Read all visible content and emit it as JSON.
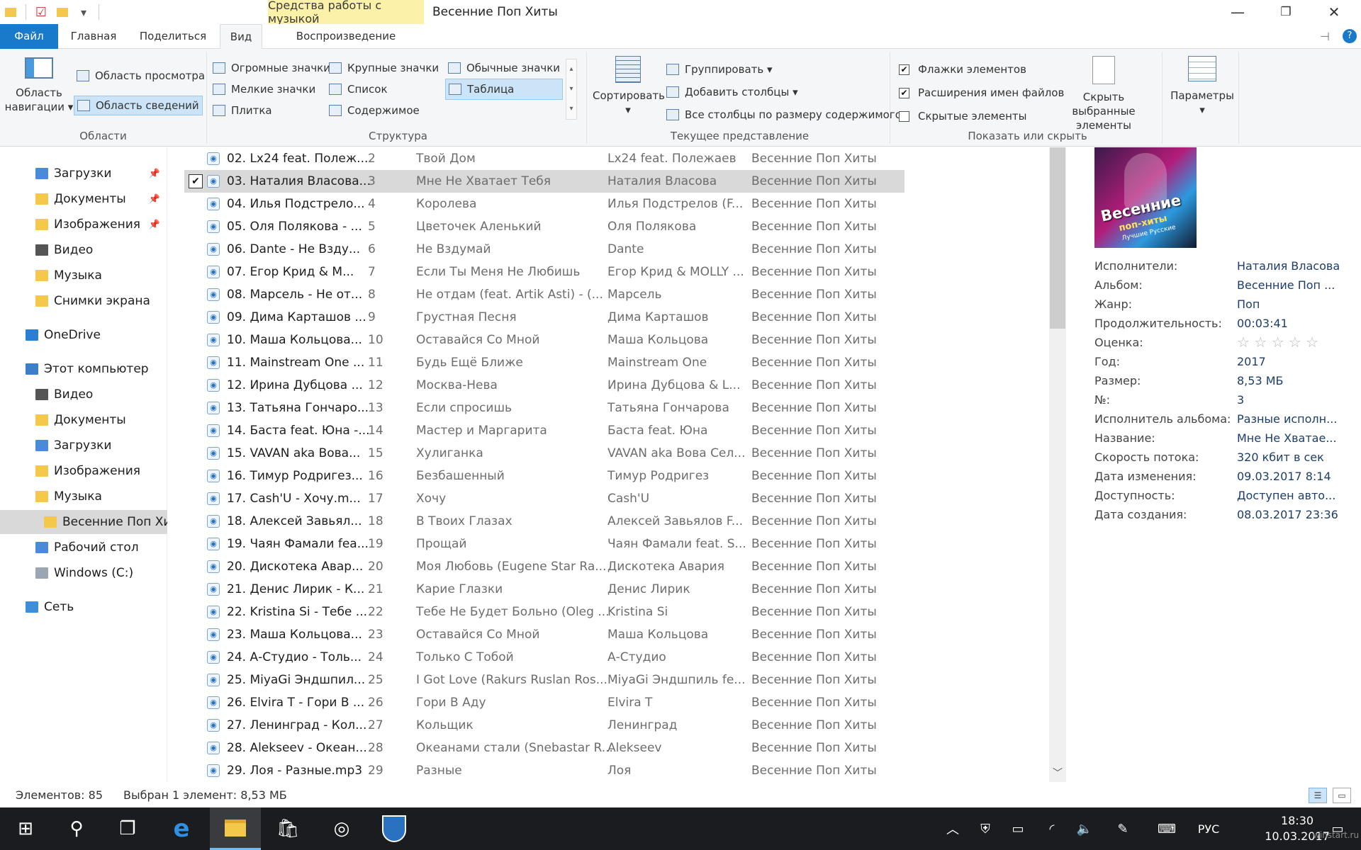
{
  "window": {
    "title": "Весенние Поп Хиты",
    "context_tab_group": "Средства работы с музыкой",
    "minimize": "—",
    "maximize": "❐",
    "close": "✕"
  },
  "tabs": {
    "file": "Файл",
    "home": "Главная",
    "share": "Поделиться",
    "view": "Вид",
    "playback": "Воспроизведение"
  },
  "ribbon": {
    "panes": {
      "nav_pane": "Область навигации",
      "preview_pane": "Область просмотра",
      "details_pane": "Область сведений",
      "group_label": "Области"
    },
    "layout": {
      "extra_large": "Огромные значки",
      "large": "Крупные значки",
      "medium": "Обычные значки",
      "small": "Мелкие значки",
      "list": "Список",
      "details": "Таблица",
      "tiles": "Плитка",
      "content": "Содержимое",
      "group_label": "Структура"
    },
    "current_view": {
      "sort": "Сортировать",
      "group_by": "Группировать",
      "add_columns": "Добавить столбцы",
      "size_all_columns": "Все столбцы по размеру содержимого",
      "group_label": "Текущее представление"
    },
    "show_hide": {
      "item_checkboxes": "Флажки элементов",
      "file_extensions": "Расширения имен файлов",
      "hidden_items": "Скрытые элементы",
      "item_checkboxes_checked": true,
      "file_extensions_checked": true,
      "hidden_items_checked": false,
      "hide_selected": "Скрыть выбранные элементы",
      "group_label": "Показать или скрыть"
    },
    "options": "Параметры"
  },
  "nav": {
    "items": [
      {
        "label": "Загрузки",
        "pinned": true
      },
      {
        "label": "Документы",
        "pinned": true
      },
      {
        "label": "Изображения",
        "pinned": true
      },
      {
        "label": "Видео",
        "pinned": false
      },
      {
        "label": "Музыка",
        "pinned": false
      },
      {
        "label": "Снимки экрана",
        "pinned": false
      },
      {
        "label": "OneDrive",
        "pinned": false
      },
      {
        "label": "Этот компьютер",
        "pinned": false
      },
      {
        "label": "Видео",
        "pinned": false
      },
      {
        "label": "Документы",
        "pinned": false
      },
      {
        "label": "Загрузки",
        "pinned": false
      },
      {
        "label": "Изображения",
        "pinned": false
      },
      {
        "label": "Музыка",
        "pinned": false
      },
      {
        "label": "Весенние Поп Хиты",
        "pinned": false
      },
      {
        "label": "Рабочий стол",
        "pinned": false
      },
      {
        "label": "Windows (C:)",
        "pinned": false
      },
      {
        "label": "Сеть",
        "pinned": false
      }
    ]
  },
  "files": [
    {
      "name": "02. Lx24 feat. Полеж...",
      "num": "2",
      "title": "Твой Дом",
      "artist": "Lx24 feat. Полежаев",
      "album": "Весенние Поп Хиты"
    },
    {
      "name": "03. Наталия Власова...",
      "num": "3",
      "title": "Мне Не Хватает Тебя",
      "artist": "Наталия Власова",
      "album": "Весенние Поп Хиты"
    },
    {
      "name": "04. Илья Подстрело...",
      "num": "4",
      "title": "Королева",
      "artist": "Илья Подстрелов (F...",
      "album": "Весенние Поп Хиты"
    },
    {
      "name": "05. Оля Полякова - ...",
      "num": "5",
      "title": "Цветочек Аленький",
      "artist": "Оля Полякова",
      "album": "Весенние Поп Хиты"
    },
    {
      "name": "06. Dante - Не Взду...",
      "num": "6",
      "title": "Не Вздумай",
      "artist": "Dante",
      "album": "Весенние Поп Хиты"
    },
    {
      "name": "07. Егор Крид & M...",
      "num": "7",
      "title": "Если Ты Меня Не Любишь",
      "artist": "Егор Крид & MOLLY ...",
      "album": "Весенние Поп Хиты"
    },
    {
      "name": "08. Марсель - Не от...",
      "num": "8",
      "title": "Не отдам (feat. Artik Asti) - (...",
      "artist": "Марсель",
      "album": "Весенние Поп Хиты"
    },
    {
      "name": "09. Дима Карташов ...",
      "num": "9",
      "title": "Грустная Песня",
      "artist": "Дима Карташов",
      "album": "Весенние Поп Хиты"
    },
    {
      "name": "10. Маша Кольцова...",
      "num": "10",
      "title": "Оставайся Со Мной",
      "artist": "Маша Кольцова",
      "album": "Весенние Поп Хиты"
    },
    {
      "name": "11. Mainstream One ...",
      "num": "11",
      "title": "Будь Ещё Ближе",
      "artist": "Mainstream One",
      "album": "Весенние Поп Хиты"
    },
    {
      "name": "12. Ирина Дубцова ...",
      "num": "12",
      "title": "Москва-Нева",
      "artist": "Ирина Дубцова & L...",
      "album": "Весенние Поп Хиты"
    },
    {
      "name": "13. Татьяна Гончаро...",
      "num": "13",
      "title": "Если спросишь",
      "artist": "Татьяна Гончарова",
      "album": "Весенние Поп Хиты"
    },
    {
      "name": "14. Баста feat. Юна -...",
      "num": "14",
      "title": "Мастер и Маргарита",
      "artist": "Баста feat. Юна",
      "album": "Весенние Поп Хиты"
    },
    {
      "name": "15. VAVAN aka Вова...",
      "num": "15",
      "title": "Хулиганка",
      "artist": "VAVAN aka Вова Сел...",
      "album": "Весенние Поп Хиты"
    },
    {
      "name": "16. Тимур Родригез...",
      "num": "16",
      "title": "Безбашенный",
      "artist": "Тимур Родригез",
      "album": "Весенние Поп Хиты"
    },
    {
      "name": "17. Cash'U - Хочу.m...",
      "num": "17",
      "title": "Хочу",
      "artist": "Cash'U",
      "album": "Весенние Поп Хиты"
    },
    {
      "name": "18. Алексей Завьял...",
      "num": "18",
      "title": "В Твоих Глазах",
      "artist": "Алексей Завьялов F...",
      "album": "Весенние Поп Хиты"
    },
    {
      "name": "19. Чаян Фамали fea...",
      "num": "19",
      "title": "Прощай",
      "artist": "Чаян Фамали feat. S...",
      "album": "Весенние Поп Хиты"
    },
    {
      "name": "20. Дискотека Авар...",
      "num": "20",
      "title": "Моя Любовь (Eugene Star Ra...",
      "artist": "Дискотека Авария",
      "album": "Весенние Поп Хиты"
    },
    {
      "name": "21. Денис Лирик - К...",
      "num": "21",
      "title": "Карие Глазки",
      "artist": "Денис Лирик",
      "album": "Весенние Поп Хиты"
    },
    {
      "name": "22. Kristina Si - Тебе ...",
      "num": "22",
      "title": "Тебе Не Будет Больно (Oleg ...",
      "artist": "Kristina Si",
      "album": "Весенние Поп Хиты"
    },
    {
      "name": "23. Маша Кольцова...",
      "num": "23",
      "title": "Оставайся Со Мной",
      "artist": "Маша Кольцова",
      "album": "Весенние Поп Хиты"
    },
    {
      "name": "24. А-Студио - Толь...",
      "num": "24",
      "title": "Только С Тобой",
      "artist": "А-Студио",
      "album": "Весенние Поп Хиты"
    },
    {
      "name": "25. MiyaGi Эндшпил...",
      "num": "25",
      "title": "I Got Love (Rakurs Ruslan Ros...",
      "artist": "MiyaGi Эндшпиль fe...",
      "album": "Весенние Поп Хиты"
    },
    {
      "name": "26. Elvira T - Гори В ...",
      "num": "26",
      "title": "Гори В Аду",
      "artist": "Elvira T",
      "album": "Весенние Поп Хиты"
    },
    {
      "name": "27. Ленинград - Кол...",
      "num": "27",
      "title": "Кольщик",
      "artist": "Ленинград",
      "album": "Весенние Поп Хиты"
    },
    {
      "name": "28. Alekseev - Океан...",
      "num": "28",
      "title": "Океанами стали (Snebastar R...",
      "artist": "Alekseev",
      "album": "Весенние Поп Хиты"
    },
    {
      "name": "29. Лоя - Разные.mp3",
      "num": "29",
      "title": "Разные",
      "artist": "Лоя",
      "album": "Весенние Поп Хиты"
    }
  ],
  "selected_row": 1,
  "details": {
    "art_text_main": "Весенние",
    "art_text_sub": "поп-хиты",
    "art_text_small": "Лучшие Русские",
    "props": [
      {
        "k": "Исполнители:",
        "v": "Наталия Власова"
      },
      {
        "k": "Альбом:",
        "v": "Весенние Поп ..."
      },
      {
        "k": "Жанр:",
        "v": "Поп"
      },
      {
        "k": "Продолжительность:",
        "v": "00:03:41"
      },
      {
        "k": "Оценка:",
        "v": "☆ ☆ ☆ ☆ ☆"
      },
      {
        "k": "Год:",
        "v": "2017"
      },
      {
        "k": "Размер:",
        "v": "8,53 МБ"
      },
      {
        "k": "№:",
        "v": "3"
      },
      {
        "k": "Исполнитель альбома:",
        "v": "Разные исполн..."
      },
      {
        "k": "Название:",
        "v": "Мне Не Хватае..."
      },
      {
        "k": "Скорость потока:",
        "v": "320 кбит в сек"
      },
      {
        "k": "Дата изменения:",
        "v": "09.03.2017 8:14"
      },
      {
        "k": "Доступность:",
        "v": "Доступен авто..."
      },
      {
        "k": "Дата создания:",
        "v": "08.03.2017 23:36"
      }
    ]
  },
  "status": {
    "count": "Элементов: 85",
    "selection": "Выбран 1 элемент: 8,53 МБ"
  },
  "taskbar": {
    "lang": "РУС",
    "time": "18:30",
    "date": "10.03.2017",
    "watermark": "winstart.ru"
  },
  "colors": {
    "accent": "#1979ca",
    "context_tab": "#fcf1a8",
    "selection": "#d9d9d9",
    "taskbar": "#1b1c1f"
  }
}
